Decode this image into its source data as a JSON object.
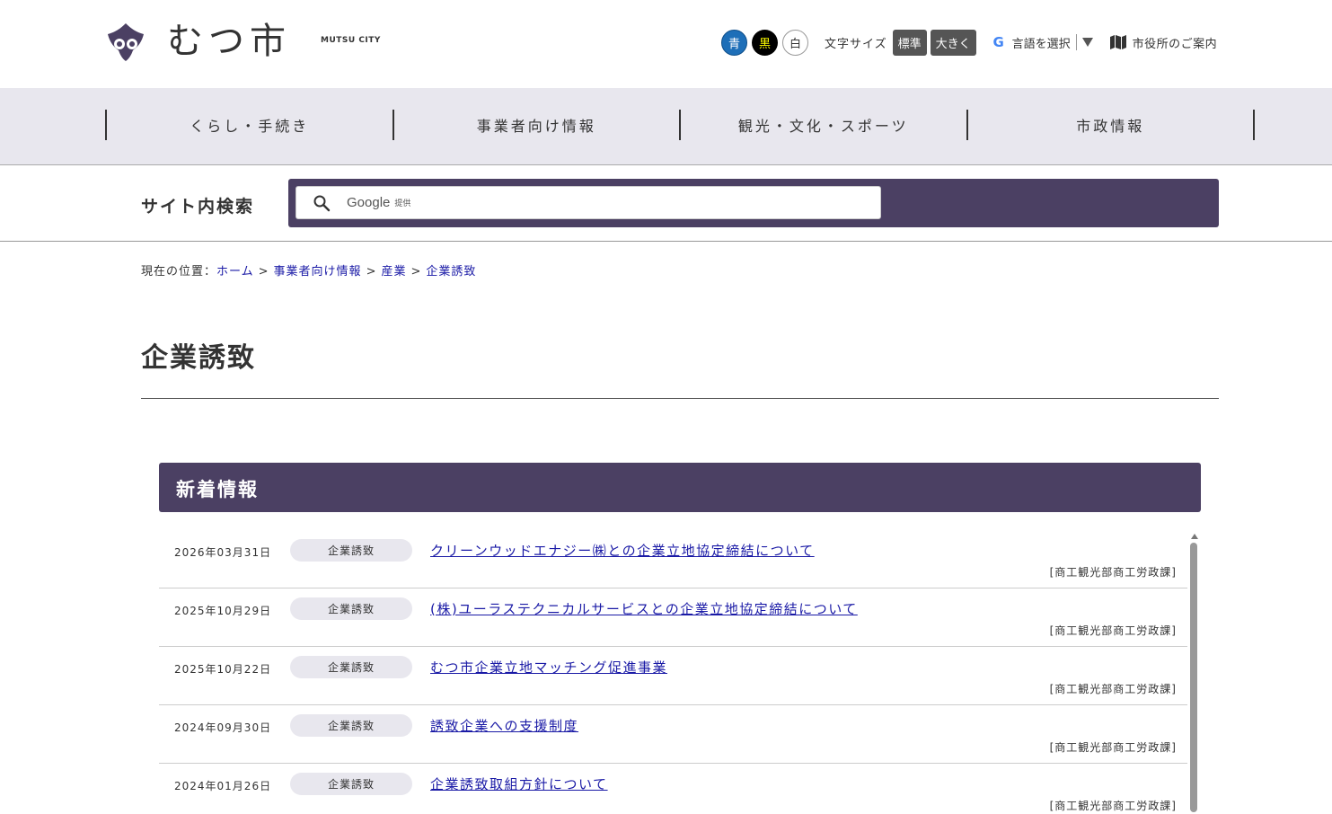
{
  "header": {
    "logo_text": "むつ市",
    "logo_sub": "MUTSU CITY",
    "color_buttons": [
      "青",
      "黒",
      "白"
    ],
    "font_size_label": "文字サイズ",
    "font_size_standard": "標準",
    "font_size_large": "大きく",
    "language_label": "言語を選択",
    "guide_label": "市役所のご案内"
  },
  "nav": {
    "items": [
      "くらし・手続き",
      "事業者向け情報",
      "観光・文化・スポーツ",
      "市政情報"
    ]
  },
  "search": {
    "label": "サイト内検索",
    "brand": "Google",
    "provided": "提供"
  },
  "breadcrumb": {
    "prefix": "現在の位置：",
    "items": [
      "ホーム",
      "事業者向け情報",
      "産業",
      "企業誘致"
    ],
    "separator": ">"
  },
  "page": {
    "title": "企業誘致"
  },
  "news": {
    "heading": "新着情報",
    "items": [
      {
        "date": "2026年03月31日",
        "tag": "企業誘致",
        "title": "クリーンウッドエナジー㈱との企業立地協定締結について",
        "dept": "[商工観光部商工労政課]"
      },
      {
        "date": "2025年10月29日",
        "tag": "企業誘致",
        "title": "(株)ユーラステクニカルサービスとの企業立地協定締結について",
        "dept": "[商工観光部商工労政課]"
      },
      {
        "date": "2025年10月22日",
        "tag": "企業誘致",
        "title": "むつ市企業立地マッチング促進事業",
        "dept": "[商工観光部商工労政課]"
      },
      {
        "date": "2024年09月30日",
        "tag": "企業誘致",
        "title": "誘致企業への支援制度",
        "dept": "[商工観光部商工労政課]"
      },
      {
        "date": "2024年01月26日",
        "tag": "企業誘致",
        "title": "企業誘致取組方針について",
        "dept": "[商工観光部商工労政課]"
      }
    ]
  },
  "colors": {
    "accent": "#4b4063",
    "nav_bg": "#e8e7ee",
    "link": "#1a1aa6"
  }
}
